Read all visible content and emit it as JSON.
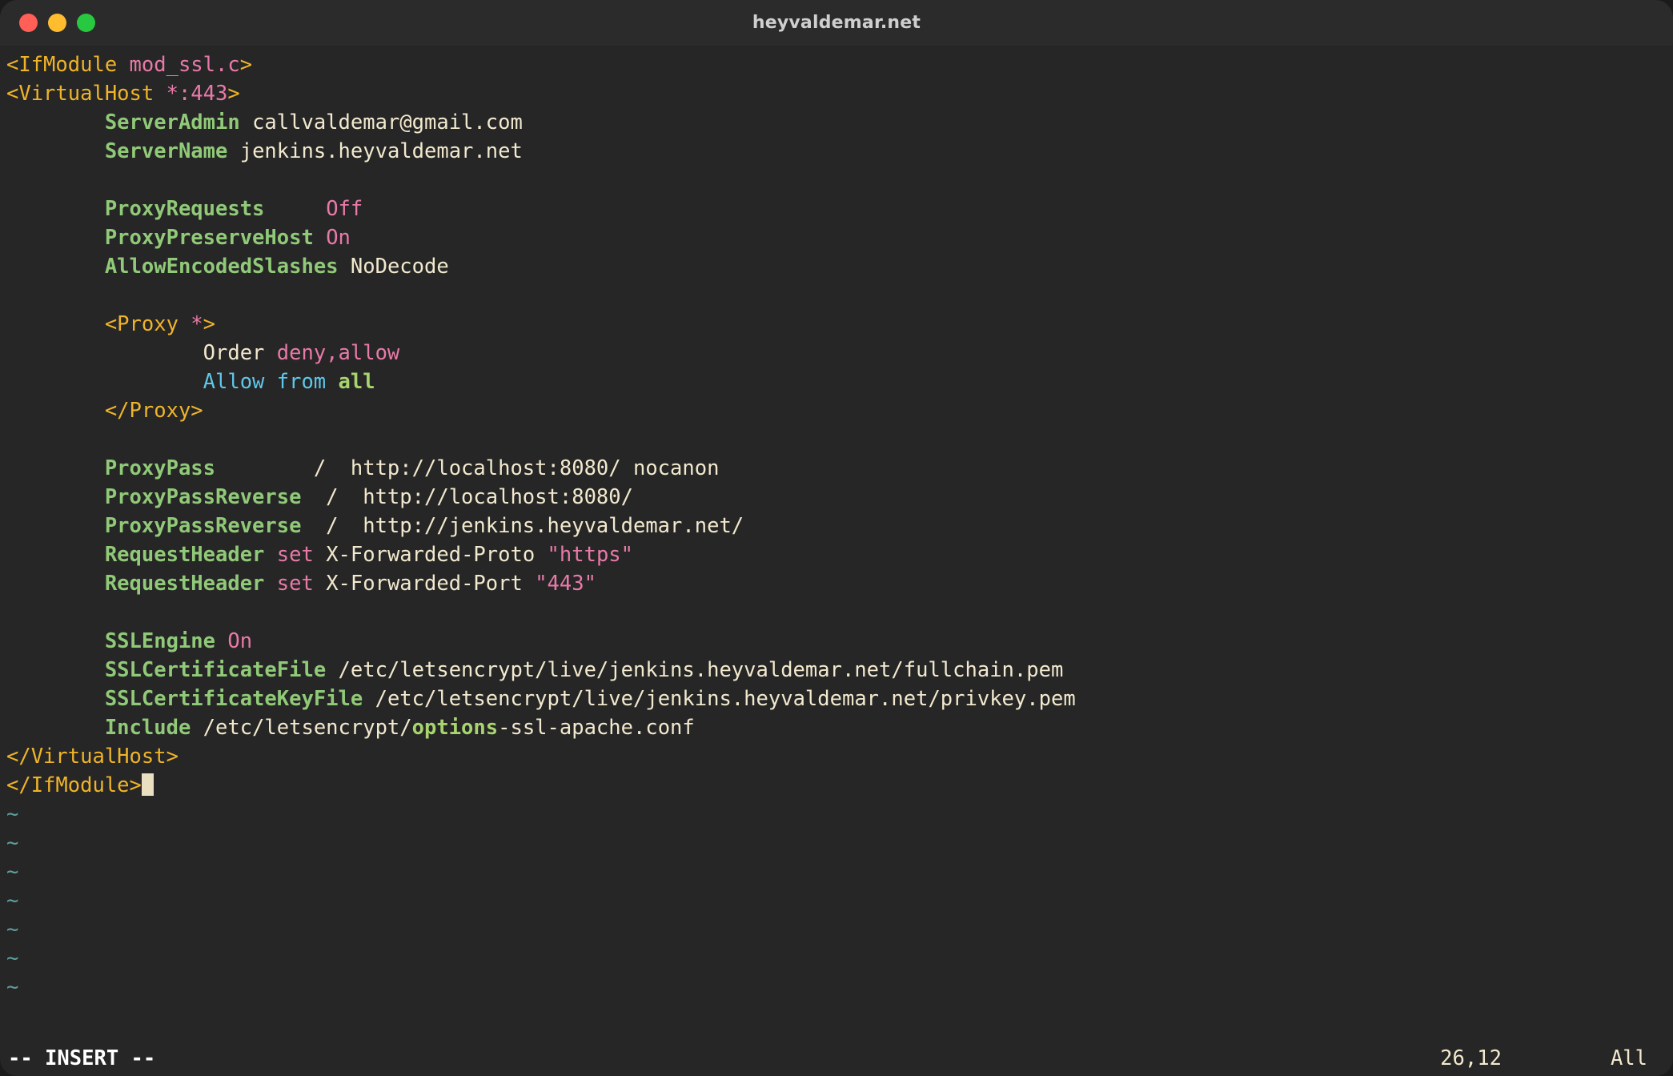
{
  "window": {
    "title": "heyvaldemar.net",
    "traffic_lights": [
      {
        "name": "close",
        "color": "#ff5f57"
      },
      {
        "name": "minimize",
        "color": "#febc2e"
      },
      {
        "name": "maximize",
        "color": "#28c840"
      }
    ]
  },
  "theme": {
    "background": "#262626",
    "titlebar": "#2b2b2b",
    "tag": "#f0b429",
    "tag_args": "#e87aa8",
    "directive": "#90c978",
    "value": "#f2e9ce",
    "keyword": "#e87aa8",
    "blue": "#5fc7ea",
    "green_bold": "#a8d46f",
    "tilde": "#5f9ea0",
    "cursor": "#eadfc0",
    "status_text": "#ffffff"
  },
  "editor": {
    "application": "vim",
    "mode": "-- INSERT --",
    "cursor_position": "26,12",
    "scroll_position": "All",
    "empty_line_marker": "~",
    "empty_line_count": 7,
    "lines": [
      {
        "n": 1,
        "segs": [
          {
            "t": "<IfModule ",
            "c": "tag"
          },
          {
            "t": "mod_ssl.c",
            "c": "tagargs"
          },
          {
            "t": ">",
            "c": "tag"
          }
        ]
      },
      {
        "n": 2,
        "segs": [
          {
            "t": "<VirtualHost ",
            "c": "tag"
          },
          {
            "t": "*:443",
            "c": "tagargs"
          },
          {
            "t": ">",
            "c": "tag"
          }
        ]
      },
      {
        "n": 3,
        "segs": [
          {
            "t": "        ",
            "c": "val"
          },
          {
            "t": "ServerAdmin",
            "c": "dir"
          },
          {
            "t": " callvaldemar@gmail.com",
            "c": "val"
          }
        ]
      },
      {
        "n": 4,
        "segs": [
          {
            "t": "        ",
            "c": "val"
          },
          {
            "t": "ServerName",
            "c": "dir"
          },
          {
            "t": " jenkins.heyvaldemar.net",
            "c": "val"
          }
        ]
      },
      {
        "n": 5,
        "segs": []
      },
      {
        "n": 6,
        "segs": [
          {
            "t": "        ",
            "c": "val"
          },
          {
            "t": "ProxyRequests",
            "c": "dir"
          },
          {
            "t": "     ",
            "c": "val"
          },
          {
            "t": "Off",
            "c": "kw"
          }
        ]
      },
      {
        "n": 7,
        "segs": [
          {
            "t": "        ",
            "c": "val"
          },
          {
            "t": "ProxyPreserveHost",
            "c": "dir"
          },
          {
            "t": " ",
            "c": "val"
          },
          {
            "t": "On",
            "c": "kw"
          }
        ]
      },
      {
        "n": 8,
        "segs": [
          {
            "t": "        ",
            "c": "val"
          },
          {
            "t": "AllowEncodedSlashes",
            "c": "dir"
          },
          {
            "t": " NoDecode",
            "c": "val"
          }
        ]
      },
      {
        "n": 9,
        "segs": []
      },
      {
        "n": 10,
        "segs": [
          {
            "t": "        ",
            "c": "val"
          },
          {
            "t": "<Proxy ",
            "c": "tag"
          },
          {
            "t": "*",
            "c": "tagargs"
          },
          {
            "t": ">",
            "c": "tag"
          }
        ]
      },
      {
        "n": 11,
        "segs": [
          {
            "t": "                ",
            "c": "val"
          },
          {
            "t": "Order ",
            "c": "val"
          },
          {
            "t": "deny,allow",
            "c": "kw"
          }
        ]
      },
      {
        "n": 12,
        "segs": [
          {
            "t": "                ",
            "c": "val"
          },
          {
            "t": "Allow from ",
            "c": "blue"
          },
          {
            "t": "all",
            "c": "greenb"
          }
        ]
      },
      {
        "n": 13,
        "segs": [
          {
            "t": "        ",
            "c": "val"
          },
          {
            "t": "</Proxy>",
            "c": "tag"
          }
        ]
      },
      {
        "n": 14,
        "segs": []
      },
      {
        "n": 15,
        "segs": [
          {
            "t": "        ",
            "c": "val"
          },
          {
            "t": "ProxyPass",
            "c": "dir"
          },
          {
            "t": "        /  http://localhost:8080/ nocanon",
            "c": "val"
          }
        ]
      },
      {
        "n": 16,
        "segs": [
          {
            "t": "        ",
            "c": "val"
          },
          {
            "t": "ProxyPassReverse",
            "c": "dir"
          },
          {
            "t": "  /  http://localhost:8080/",
            "c": "val"
          }
        ]
      },
      {
        "n": 17,
        "segs": [
          {
            "t": "        ",
            "c": "val"
          },
          {
            "t": "ProxyPassReverse",
            "c": "dir"
          },
          {
            "t": "  /  http://jenkins.heyvaldemar.net/",
            "c": "val"
          }
        ]
      },
      {
        "n": 18,
        "segs": [
          {
            "t": "        ",
            "c": "val"
          },
          {
            "t": "RequestHeader",
            "c": "dir"
          },
          {
            "t": " ",
            "c": "val"
          },
          {
            "t": "set",
            "c": "kw"
          },
          {
            "t": " X-Forwarded-Proto ",
            "c": "val"
          },
          {
            "t": "\"https\"",
            "c": "kw"
          }
        ]
      },
      {
        "n": 19,
        "segs": [
          {
            "t": "        ",
            "c": "val"
          },
          {
            "t": "RequestHeader",
            "c": "dir"
          },
          {
            "t": " ",
            "c": "val"
          },
          {
            "t": "set",
            "c": "kw"
          },
          {
            "t": " X-Forwarded-Port ",
            "c": "val"
          },
          {
            "t": "\"443\"",
            "c": "kw"
          }
        ]
      },
      {
        "n": 20,
        "segs": []
      },
      {
        "n": 21,
        "segs": [
          {
            "t": "        ",
            "c": "val"
          },
          {
            "t": "SSLEngine",
            "c": "dir"
          },
          {
            "t": " ",
            "c": "val"
          },
          {
            "t": "On",
            "c": "kw"
          }
        ]
      },
      {
        "n": 22,
        "segs": [
          {
            "t": "        ",
            "c": "val"
          },
          {
            "t": "SSLCertificateFile",
            "c": "dir"
          },
          {
            "t": " /etc/letsencrypt/live/jenkins.heyvaldemar.net/fullchain.pem",
            "c": "val"
          }
        ]
      },
      {
        "n": 23,
        "segs": [
          {
            "t": "        ",
            "c": "val"
          },
          {
            "t": "SSLCertificateKeyFile",
            "c": "dir"
          },
          {
            "t": " /etc/letsencrypt/live/jenkins.heyvaldemar.net/privkey.pem",
            "c": "val"
          }
        ]
      },
      {
        "n": 24,
        "segs": [
          {
            "t": "        ",
            "c": "val"
          },
          {
            "t": "Include",
            "c": "dir"
          },
          {
            "t": " /etc/letsencrypt/",
            "c": "val"
          },
          {
            "t": "options",
            "c": "greenb"
          },
          {
            "t": "-ssl-apache.conf",
            "c": "val"
          }
        ]
      },
      {
        "n": 25,
        "segs": [
          {
            "t": "</VirtualHost>",
            "c": "tag"
          }
        ]
      },
      {
        "n": 26,
        "segs": [
          {
            "t": "</IfModule>",
            "c": "tag"
          }
        ],
        "cursor": true
      }
    ]
  }
}
